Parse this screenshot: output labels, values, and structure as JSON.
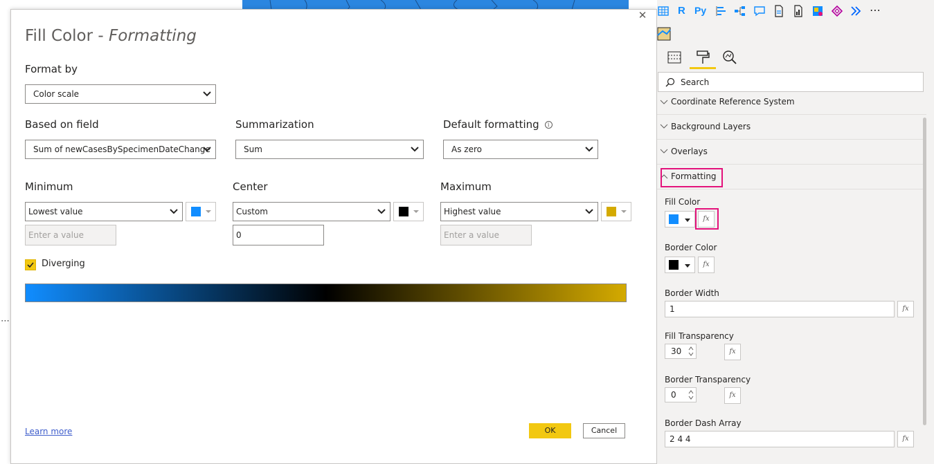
{
  "dialog": {
    "title_main": "Fill Color - ",
    "title_italic": "Formatting",
    "format_by": {
      "label": "Format by",
      "value": "Color scale"
    },
    "based_on_field": {
      "label": "Based on field",
      "value": "Sum of newCasesBySpecimenDateChange"
    },
    "summarization": {
      "label": "Summarization",
      "value": "Sum"
    },
    "default_formatting": {
      "label": "Default formatting",
      "value": "As zero"
    },
    "minimum": {
      "label": "Minimum",
      "value": "Lowest value",
      "color": "#118dff",
      "input_placeholder": "Enter a value"
    },
    "center": {
      "label": "Center",
      "value": "Custom",
      "color": "#000000",
      "input_value": "0"
    },
    "maximum": {
      "label": "Maximum",
      "value": "Highest value",
      "color": "#d4aa00",
      "input_placeholder": "Enter a value"
    },
    "diverging": {
      "label": "Diverging",
      "checked": true
    },
    "gradient_colors": [
      "#118dff",
      "#000000",
      "#d4aa00"
    ],
    "learn_more": "Learn more",
    "ok": "OK",
    "cancel": "Cancel"
  },
  "pane": {
    "search_placeholder": "Search",
    "sections": [
      "Coordinate Reference System",
      "Background Layers",
      "Overlays",
      "Formatting"
    ],
    "fill_color": {
      "label": "Fill Color",
      "color": "#118dff"
    },
    "border_color": {
      "label": "Border Color",
      "color": "#000000"
    },
    "border_width": {
      "label": "Border Width",
      "value": "1"
    },
    "fill_transparency": {
      "label": "Fill Transparency",
      "value": "30"
    },
    "border_transparency": {
      "label": "Border Transparency",
      "value": "0"
    },
    "border_dash_array": {
      "label": "Border Dash Array",
      "value": "2 4 4"
    },
    "fx_label": "fx"
  },
  "toolbar_icons": [
    "table-icon",
    "r-visual-icon",
    "python-visual-icon",
    "key-influencers-icon",
    "decomposition-tree-icon",
    "qa-icon",
    "smart-narrative-icon",
    "paginated-report-icon",
    "custom-visual-icon",
    "power-apps-icon",
    "power-automate-icon",
    "more-icon",
    "map-visual-icon"
  ],
  "accent": "#f2c811",
  "highlight": "#e3127b"
}
